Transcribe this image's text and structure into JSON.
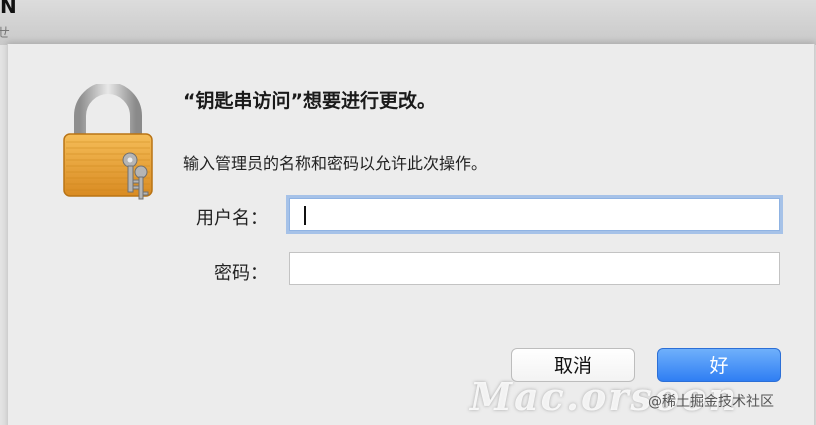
{
  "background_window": {
    "title_fragment": "N",
    "side_glyph": "ㄝ"
  },
  "dialog": {
    "title": "“钥匙串访问”想要进行更改。",
    "message": "输入管理员的名称和密码以允许此次操作。",
    "username_label": "用户名：",
    "username_value": "",
    "password_label": "密码：",
    "password_value": "",
    "cancel_label": "取消",
    "ok_label": "好"
  },
  "icons": {
    "lock": "lock-icon"
  },
  "colors": {
    "ok_button": "#2f7ef3",
    "focus_ring": "#6ea0e6",
    "lock_gold": "#e9a23a"
  },
  "watermark": {
    "text": "Mac.orsoon",
    "credit": "@稀土掘金技术社区"
  }
}
